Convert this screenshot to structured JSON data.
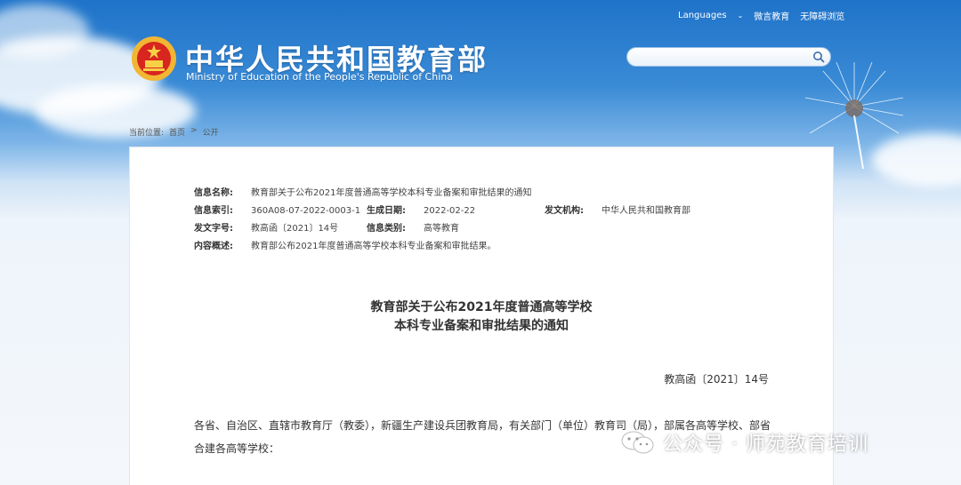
{
  "header": {
    "links": [
      "Languages",
      "微言教育",
      "无障碍浏览"
    ],
    "ministry_cn": "中华人民共和国教育部",
    "ministry_en": "Ministry of Education of the People's Republic of China",
    "search_placeholder": ""
  },
  "breadcrumb": {
    "label": "当前位置:",
    "home": "首页",
    "sep": ">",
    "current": "公开"
  },
  "meta": {
    "name_k": "信息名称:",
    "name_v": "教育部关于公布2021年度普通高等学校本科专业备案和审批结果的通知",
    "index_k": "信息索引:",
    "index_v": "360A08-07-2022-0003-1",
    "date_k": "生成日期:",
    "date_v": "2022-02-22",
    "org_k": "发文机构:",
    "org_v": "中华人民共和国教育部",
    "docno_k": "发文字号:",
    "docno_v": "教高函〔2021〕14号",
    "cat_k": "信息类别:",
    "cat_v": "高等教育",
    "summary_k": "内容概述:",
    "summary_v": "教育部公布2021年度普通高等学校本科专业备案和审批结果。"
  },
  "article": {
    "title_line1": "教育部关于公布2021年度普通高等学校",
    "title_line2": "本科专业备案和审批结果的通知",
    "doc_number": "教高函〔2021〕14号",
    "body": "各省、自治区、直辖市教育厅（教委），新疆生产建设兵团教育局，有关部门（单位）教育司（局），部属各高等学校、部省合建各高等学校："
  },
  "watermark": {
    "text": "公众号 · 师苑教育培训"
  }
}
